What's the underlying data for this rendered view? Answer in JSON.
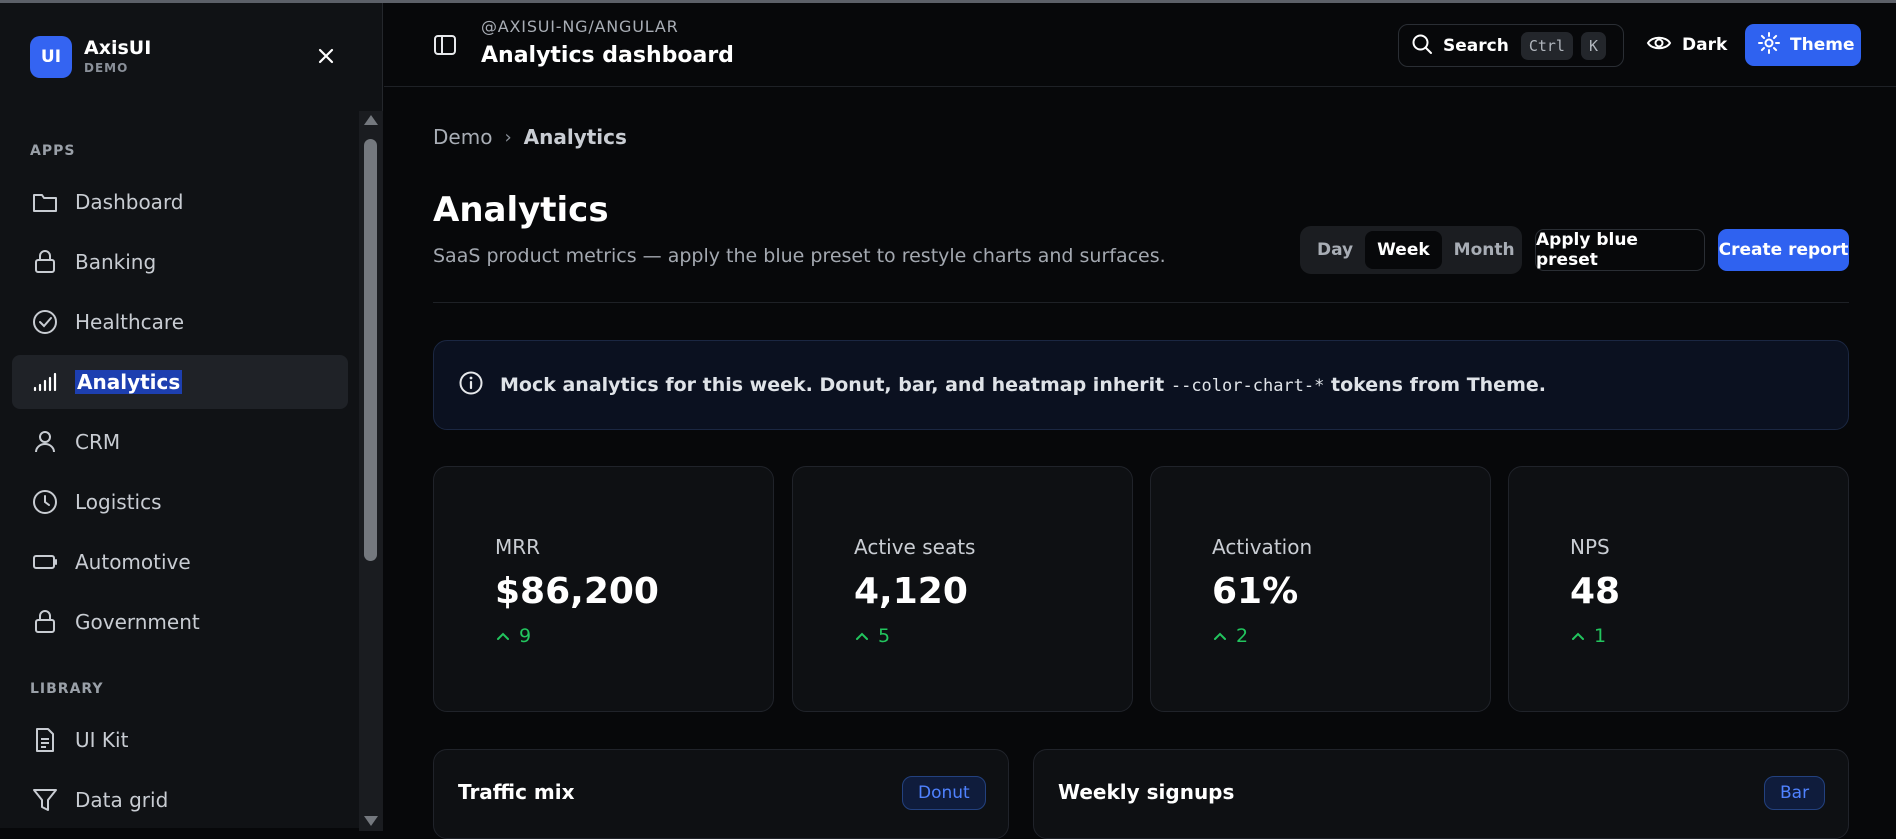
{
  "brand": {
    "logo": "UI",
    "name": "AxisUI",
    "tag": "DEMO"
  },
  "sidebar": {
    "sections": [
      {
        "label": "APPS"
      },
      {
        "label": "LIBRARY"
      }
    ],
    "items": [
      {
        "label": "Dashboard",
        "icon": "folder-icon"
      },
      {
        "label": "Banking",
        "icon": "lock-icon"
      },
      {
        "label": "Healthcare",
        "icon": "check-circle-icon"
      },
      {
        "label": "Analytics",
        "icon": "signal-bars-icon",
        "active": true
      },
      {
        "label": "CRM",
        "icon": "user-icon"
      },
      {
        "label": "Logistics",
        "icon": "clock-icon"
      },
      {
        "label": "Automotive",
        "icon": "battery-icon"
      },
      {
        "label": "Government",
        "icon": "lock-icon"
      },
      {
        "label": "UI Kit",
        "icon": "document-icon"
      },
      {
        "label": "Data grid",
        "icon": "filter-icon"
      }
    ]
  },
  "header": {
    "package": "@AXISUI-NG/ANGULAR",
    "title": "Analytics dashboard",
    "search_label": "Search",
    "kbd_ctrl": "Ctrl",
    "kbd_k": "K",
    "dark_label": "Dark",
    "theme_label": "Theme"
  },
  "breadcrumb": {
    "root": "Demo",
    "separator": "›",
    "current": "Analytics"
  },
  "page": {
    "title": "Analytics",
    "subtitle": "SaaS product metrics — apply the blue preset to restyle charts and surfaces.",
    "range_options": [
      "Day",
      "Week",
      "Month"
    ],
    "range_selected": "Week",
    "apply_label": "Apply blue preset",
    "create_label": "Create report"
  },
  "alert": {
    "text_before": "Mock analytics for this week. Donut, bar, and heatmap inherit ",
    "code": "--color-chart-*",
    "text_after": " tokens from Theme."
  },
  "kpis": [
    {
      "label": "MRR",
      "value": "$86,200",
      "delta": "9"
    },
    {
      "label": "Active seats",
      "value": "4,120",
      "delta": "5"
    },
    {
      "label": "Activation",
      "value": "61%",
      "delta": "2"
    },
    {
      "label": "NPS",
      "value": "48",
      "delta": "1"
    }
  ],
  "panels": [
    {
      "title": "Traffic mix",
      "badge": "Donut"
    },
    {
      "title": "Weekly signups",
      "badge": "Bar"
    }
  ],
  "colors": {
    "accent": "#2f62f0",
    "positive": "#22c55e",
    "background": "#07080a"
  }
}
